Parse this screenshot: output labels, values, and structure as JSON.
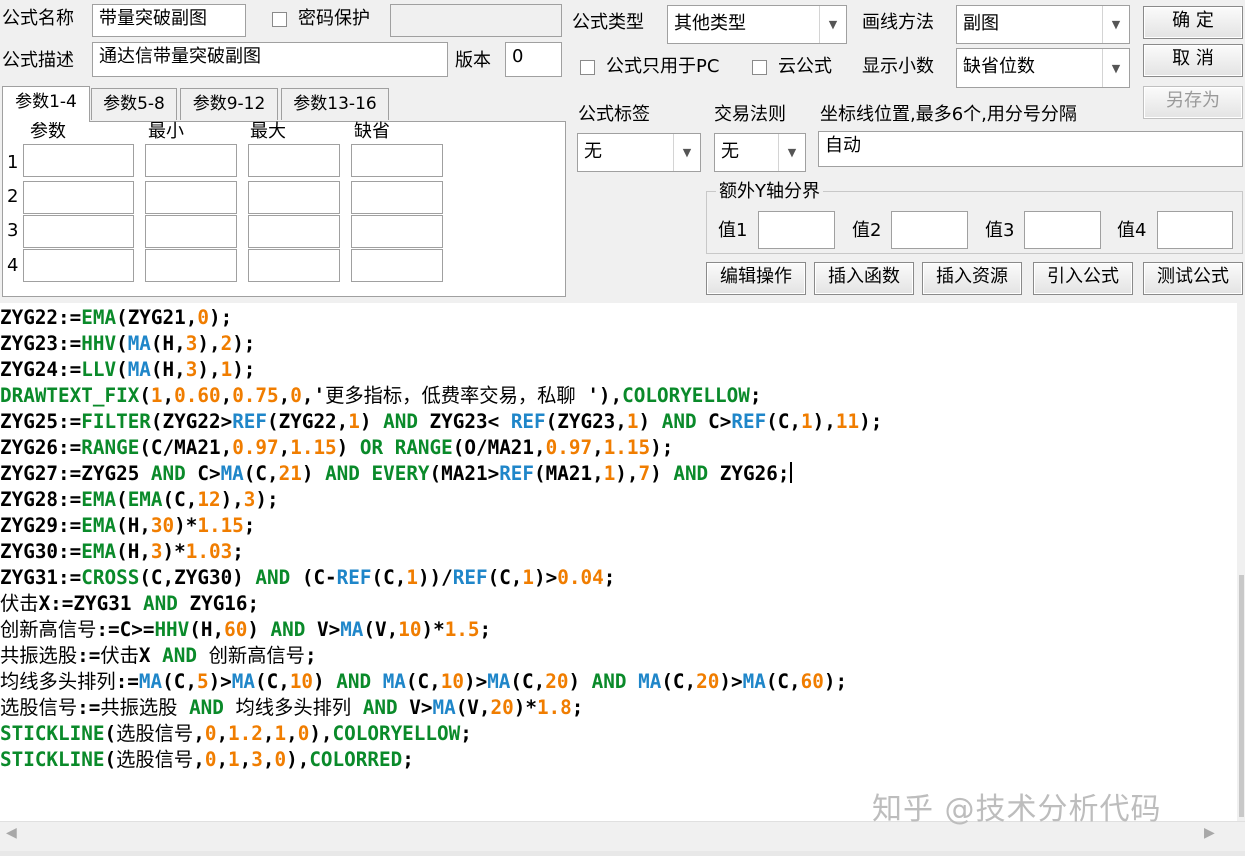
{
  "form": {
    "name_label": "公式名称",
    "name_value": "带量突破副图",
    "password_label": "密码保护",
    "password_value": "",
    "desc_label": "公式描述",
    "desc_value": "通达信带量突破副图",
    "version_label": "版本",
    "version_value": "0",
    "type_label": "公式类型",
    "type_value": "其他类型",
    "draw_label": "画线方法",
    "draw_value": "副图",
    "pc_only_label": "公式只用于PC",
    "cloud_label": "云公式",
    "decimals_label": "显示小数",
    "decimals_value": "缺省位数",
    "tag_label": "公式标签",
    "tag_value": "无",
    "rule_label": "交易法则",
    "rule_value": "无",
    "coord_label": "坐标线位置,最多6个,用分号分隔",
    "coord_value": "自动",
    "yaxis_group_label": "额外Y轴分界",
    "y_labels": [
      "值1",
      "值2",
      "值3",
      "值4"
    ]
  },
  "buttons": {
    "ok": "确 定",
    "cancel": "取 消",
    "save_as": "另存为",
    "edit": "编辑操作",
    "insert_func": "插入函数",
    "insert_res": "插入资源",
    "import": "引入公式",
    "test": "测试公式"
  },
  "tabs": [
    "参数1-4",
    "参数5-8",
    "参数9-12",
    "参数13-16"
  ],
  "param_headers": [
    "参数",
    "最小",
    "最大",
    "缺省"
  ],
  "param_rows": [
    "1",
    "2",
    "3",
    "4"
  ],
  "code_lines": [
    "ZYG22:=EMA(ZYG21,0);",
    "ZYG23:=HHV(MA(H,3),2);",
    "ZYG24:=LLV(MA(H,3),1);",
    "DRAWTEXT_FIX(1,0.60,0.75,0,'更多指标，低费率交易，私聊 '),COLORYELLOW;",
    "ZYG25:=FILTER(ZYG22>REF(ZYG22,1) AND ZYG23< REF(ZYG23,1) AND C>REF(C,1),11);",
    "ZYG26:=RANGE(C/MA21,0.97,1.15) OR RANGE(O/MA21,0.97,1.15);",
    "ZYG27:=ZYG25 AND C>MA(C,21) AND EVERY(MA21>REF(MA21,1),7) AND ZYG26;",
    "ZYG28:=EMA(EMA(C,12),3);",
    "ZYG29:=EMA(H,30)*1.15;",
    "ZYG30:=EMA(H,3)*1.03;",
    "ZYG31:=CROSS(C,ZYG30) AND (C-REF(C,1))/REF(C,1)>0.04;",
    "伏击X:=ZYG31 AND ZYG16;",
    "创新高信号:=C>=HHV(H,60) AND V>MA(V,10)*1.5;",
    "共振选股:=伏击X AND 创新高信号;",
    "均线多头排列:=MA(C,5)>MA(C,10) AND MA(C,10)>MA(C,20) AND MA(C,20)>MA(C,60);",
    "选股信号:=共振选股 AND 均线多头排列 AND V>MA(V,20)*1.8;",
    "STICKLINE(选股信号,0,1.2,1,0),COLORYELLOW;",
    "STICKLINE(选股信号,0,1,3,0),COLORRED;"
  ],
  "colors": {
    "keyword_green": "#0a8a2a",
    "function_blue": "#1f86c9",
    "number_orange": "#f07d00"
  },
  "watermark": "知乎 @技术分析代码"
}
